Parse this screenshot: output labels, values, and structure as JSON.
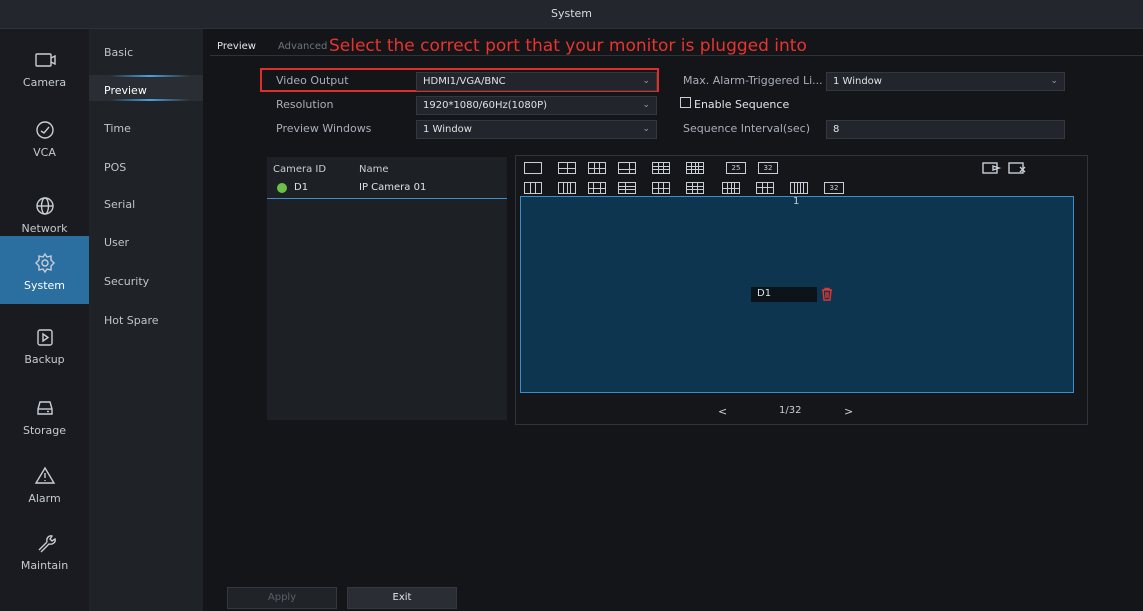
{
  "window": {
    "title": "System"
  },
  "left_nav": [
    {
      "label": "Camera",
      "icon": "camera-icon"
    },
    {
      "label": "VCA",
      "icon": "vca-icon"
    },
    {
      "label": "Network",
      "icon": "globe-icon"
    },
    {
      "label": "System",
      "icon": "gear-icon",
      "active": true
    },
    {
      "label": "Backup",
      "icon": "backup-icon"
    },
    {
      "label": "Storage",
      "icon": "storage-icon"
    },
    {
      "label": "Alarm",
      "icon": "alarm-icon"
    },
    {
      "label": "Maintain",
      "icon": "wrench-icon"
    }
  ],
  "sub_nav": [
    "Basic",
    "Preview",
    "Time",
    "POS",
    "Serial",
    "User",
    "Security",
    "Hot Spare"
  ],
  "sub_nav_active": "Preview",
  "tabs": {
    "preview": "Preview",
    "advanced": "Advanced"
  },
  "annotation": "Select the correct port that your monitor is plugged into",
  "form": {
    "video_output_label": "Video Output",
    "video_output_value": "HDMI1/VGA/BNC",
    "resolution_label": "Resolution",
    "resolution_value": "1920*1080/60Hz(1080P)",
    "preview_windows_label": "Preview Windows",
    "preview_windows_value": "1 Window",
    "max_alarm_label": "Max. Alarm-Triggered Li...",
    "max_alarm_value": "1 Window",
    "enable_sequence_label": "Enable Sequence",
    "sequence_interval_label": "Sequence Interval(sec)",
    "sequence_interval_value": "8"
  },
  "camera_list": {
    "col_id": "Camera ID",
    "col_name": "Name",
    "rows": [
      {
        "id": "D1",
        "name": "IP Camera 01",
        "status_color": "#6cc04a"
      }
    ]
  },
  "layout_options_row2": {
    "label_25": "25",
    "label_32_a": "32",
    "label_32_b": "32"
  },
  "preview": {
    "window_number": "1",
    "assigned_camera": "D1",
    "page": "1/32",
    "prev": "<",
    "next": ">"
  },
  "buttons": {
    "apply": "Apply",
    "exit": "Exit"
  },
  "colors": {
    "accent": "#2a6f9f",
    "highlight": "#e02d2a",
    "preview_bg": "#0d3550"
  }
}
